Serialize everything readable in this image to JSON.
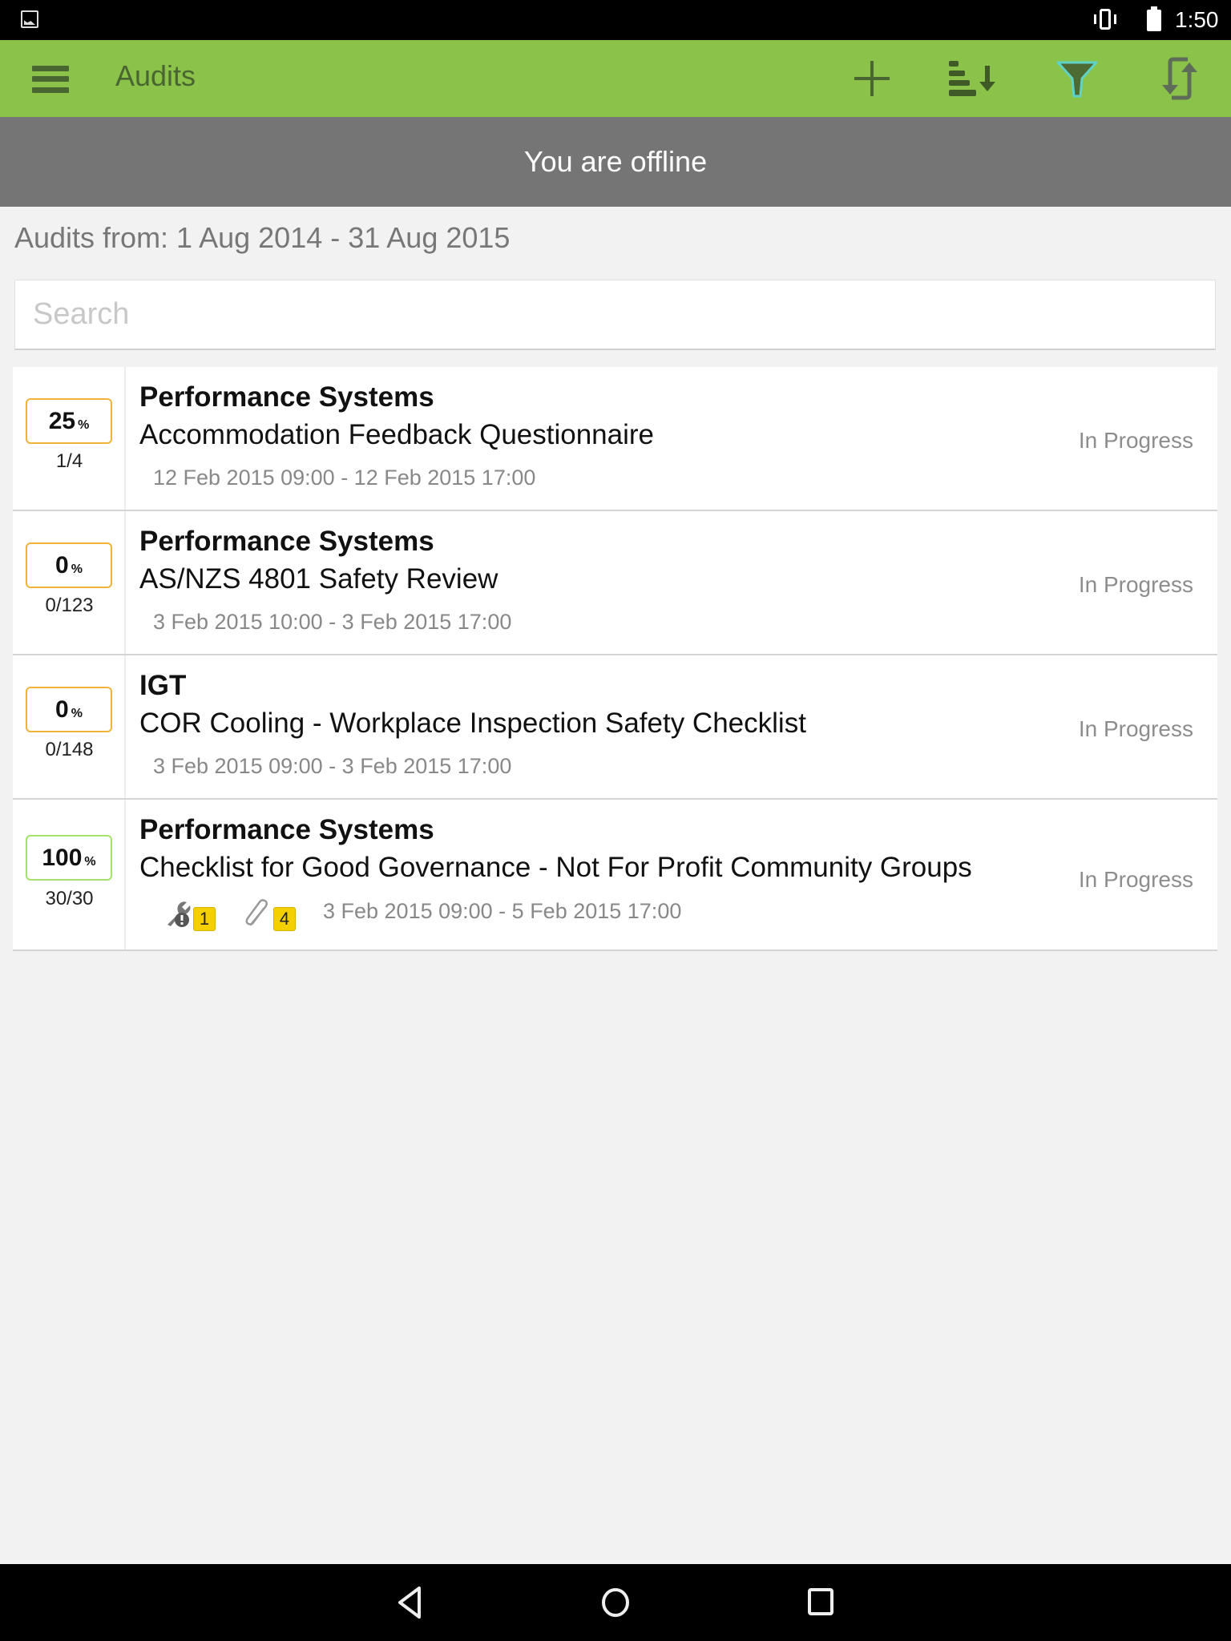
{
  "status_bar": {
    "time": "1:50",
    "icons": [
      "image-notification-icon",
      "vibrate-icon",
      "battery-icon"
    ]
  },
  "app_bar": {
    "title": "Audits",
    "actions": [
      {
        "name": "add-icon",
        "label": "Add"
      },
      {
        "name": "sort-icon",
        "label": "Sort"
      },
      {
        "name": "filter-icon",
        "label": "Filter"
      },
      {
        "name": "sync-icon",
        "label": "Sync"
      }
    ],
    "colors": {
      "background": "#8bc34a",
      "foreground": "#4a6630",
      "filter_active": "#5fd3c8"
    }
  },
  "offline_banner": {
    "text": "You are offline"
  },
  "date_range": {
    "text": "Audits from: 1 Aug 2014 - 31 Aug 2015"
  },
  "search": {
    "placeholder": "Search",
    "value": ""
  },
  "audits": [
    {
      "percent": "25",
      "percent_sign": "%",
      "progress": "1/4",
      "organization": "Performance Systems",
      "title": "Accommodation Feedback Questionnaire",
      "dates": "12 Feb 2015 09:00 - 12 Feb 2015 17:00",
      "status": "In Progress"
    },
    {
      "percent": "0",
      "percent_sign": "%",
      "progress": "0/123",
      "organization": "Performance Systems",
      "title": "AS/NZS 4801 Safety Review",
      "dates": "3 Feb 2015 10:00 - 3 Feb 2015 17:00",
      "status": "In Progress"
    },
    {
      "percent": "0",
      "percent_sign": "%",
      "progress": "0/148",
      "organization": "IGT",
      "title": "COR Cooling - Workplace Inspection Safety Checklist",
      "dates": "3 Feb 2015 09:00 - 3 Feb 2015 17:00",
      "status": "In Progress"
    },
    {
      "percent": "100",
      "percent_sign": "%",
      "progress": "30/30",
      "organization": "Performance Systems",
      "title": "Checklist for Good Governance - Not For Profit Community Groups",
      "dates": "3 Feb 2015 09:00 - 5 Feb 2015 17:00",
      "status": "In Progress",
      "actions_count": "1",
      "attachments_count": "4"
    }
  ],
  "nav_bar": {
    "buttons": [
      "back-icon",
      "home-icon",
      "recents-icon"
    ]
  }
}
